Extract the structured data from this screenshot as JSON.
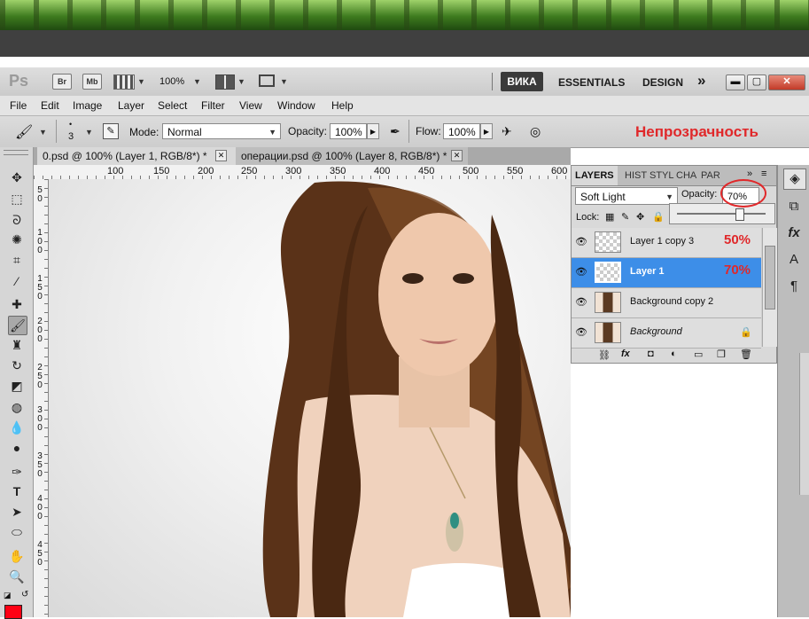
{
  "app": {
    "logo": "Ps",
    "bridge_label": "Br",
    "minibridge_label": "Mb",
    "zoom": "100%",
    "workspace_active": "ВИКА",
    "workspace_1": "ESSENTIALS",
    "workspace_2": "DESIGN",
    "more": "»"
  },
  "menu": [
    "File",
    "Edit",
    "Image",
    "Layer",
    "Select",
    "Filter",
    "View",
    "Window",
    "Help"
  ],
  "options": {
    "brush_size": "3",
    "mode_label": "Mode:",
    "mode_value": "Normal",
    "opacity_label": "Opacity:",
    "opacity_value": "100%",
    "flow_label": "Flow:",
    "flow_value": "100%"
  },
  "doc_tabs": [
    {
      "label": "0.psd @ 100% (Layer 1, RGB/8*) *"
    },
    {
      "label": "операции.psd @ 100% (Layer 8, RGB/8*) *"
    }
  ],
  "ruler_h": [
    "100",
    "150",
    "200",
    "250",
    "300",
    "350",
    "400",
    "450",
    "500",
    "550",
    "600"
  ],
  "ruler_v": [
    "5",
    "0",
    "1",
    "0",
    "0",
    "1",
    "5",
    "0",
    "2",
    "0",
    "0",
    "2",
    "5",
    "0",
    "3",
    "0",
    "0",
    "3",
    "5",
    "0",
    "4",
    "0",
    "0",
    "4",
    "5",
    "0"
  ],
  "annotation": "Непрозрачность",
  "layers_panel": {
    "tabs": [
      "LAYERS",
      "HIST",
      "STYL",
      "CHA",
      "PAR"
    ],
    "blend_mode": "Soft Light",
    "opacity_label": "Opacity:",
    "opacity_value": "70%",
    "lock_label": "Lock:",
    "opacity_slider": 0.7,
    "layers": [
      {
        "name": "Layer 1 copy 3",
        "note": "50%",
        "selected": false
      },
      {
        "name": "Layer 1",
        "note": "70%",
        "selected": true
      },
      {
        "name": "Background copy 2",
        "note": "",
        "selected": false
      },
      {
        "name": "Background",
        "note": "",
        "selected": false
      }
    ]
  },
  "colors": {
    "foreground": "#ff0014",
    "selection": "#3d8ee8",
    "annotation": "#e0282a"
  }
}
